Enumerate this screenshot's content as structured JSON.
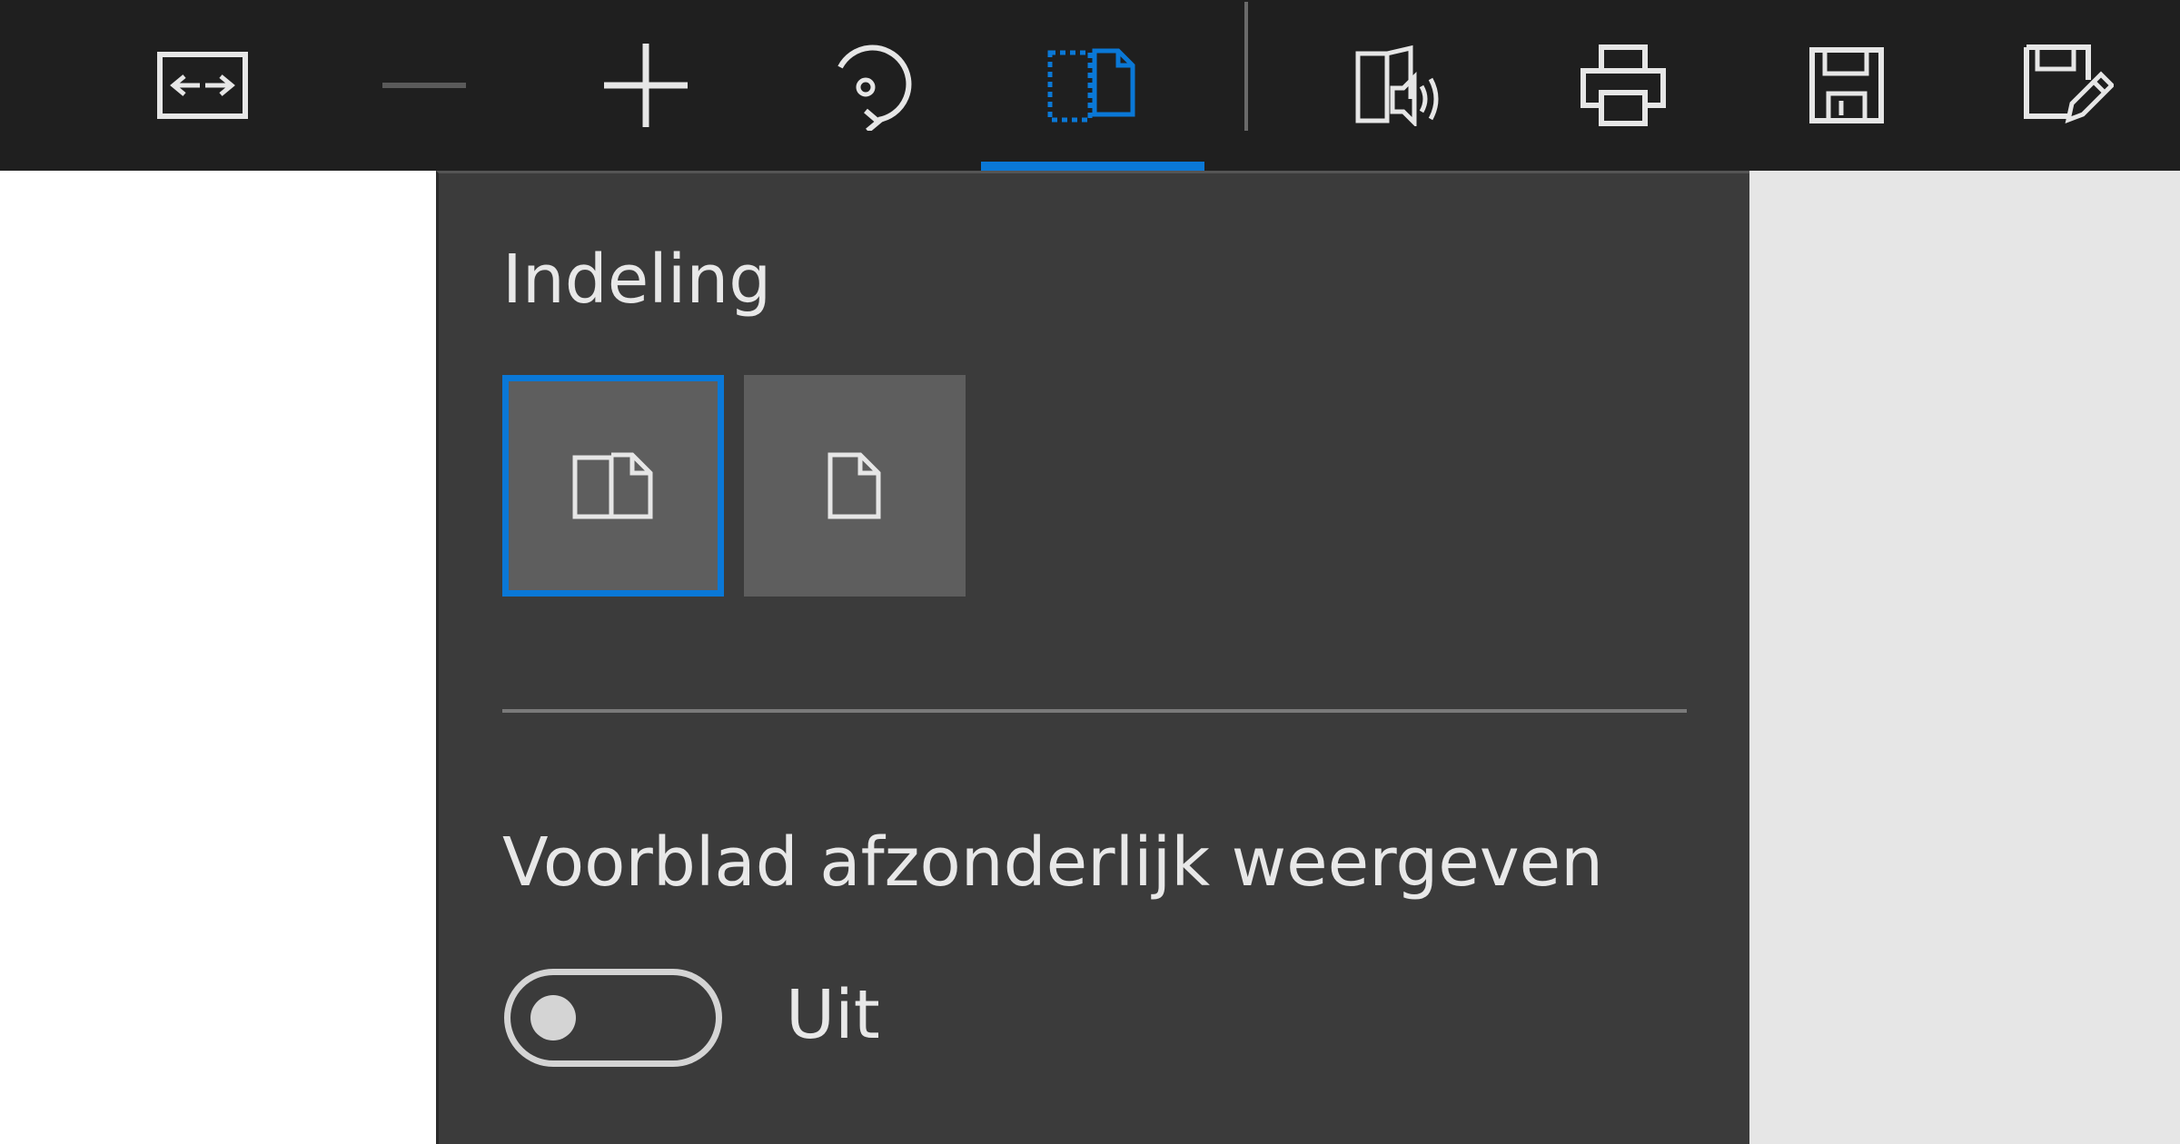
{
  "toolbar": {
    "buttons": [
      {
        "id": "fit-width",
        "icon": "fit-width-icon"
      },
      {
        "id": "zoom-out",
        "icon": "minus-icon",
        "disabled": true
      },
      {
        "id": "zoom-in",
        "icon": "plus-icon"
      },
      {
        "id": "rotate",
        "icon": "rotate-icon"
      },
      {
        "id": "page-layout",
        "icon": "page-layout-icon",
        "active": true
      },
      {
        "id": "read-aloud",
        "icon": "read-aloud-icon"
      },
      {
        "id": "print",
        "icon": "printer-icon"
      },
      {
        "id": "save",
        "icon": "save-icon"
      },
      {
        "id": "save-as",
        "icon": "save-as-icon"
      }
    ]
  },
  "flyout": {
    "heading": "Indeling",
    "layout_options": [
      {
        "id": "two-pages",
        "icon": "two-page-icon",
        "selected": true
      },
      {
        "id": "single-page",
        "icon": "single-page-icon",
        "selected": false
      }
    ],
    "option_label": "Voorblad afzonderlijk weergeven",
    "toggle_state": "Uit",
    "toggle_on": false
  },
  "colors": {
    "toolbar_bg": "#1f1f1f",
    "flyout_bg": "#3b3b3b",
    "accent": "#0a78d7",
    "icon": "#e6e6e6",
    "icon_disabled": "#5a5a5a",
    "right_pane_bg": "#e6e6e6"
  }
}
